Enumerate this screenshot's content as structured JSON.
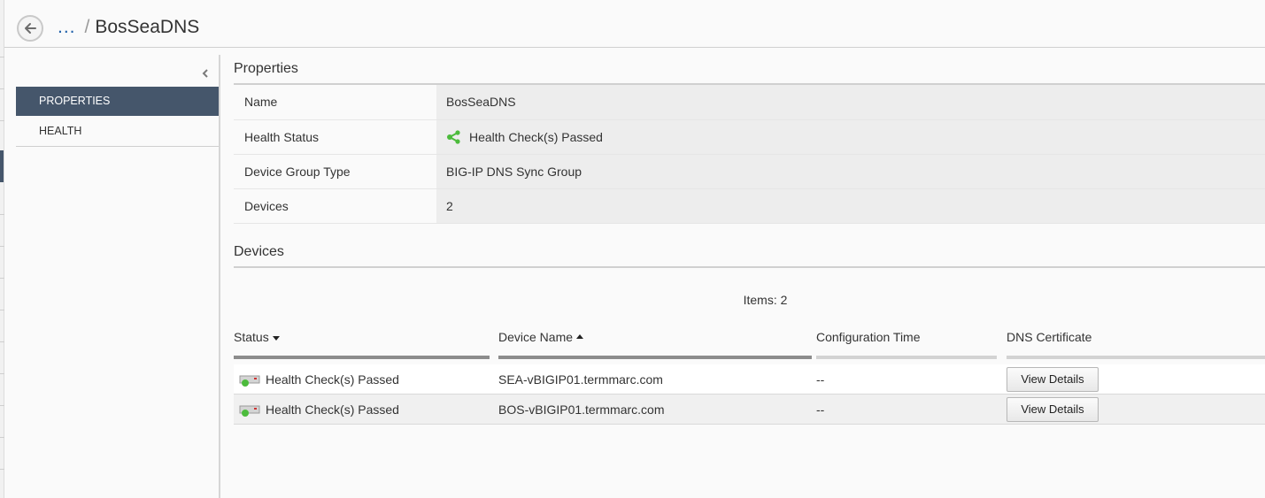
{
  "header": {
    "back_icon": "arrow-left-icon",
    "breadcrumb_more": "...",
    "breadcrumb_separator": "/",
    "breadcrumb_current": "BosSeaDNS"
  },
  "sidebar": {
    "collapse_icon": "chevron-left-icon",
    "items": [
      {
        "label": "PROPERTIES",
        "active": true
      },
      {
        "label": "HEALTH",
        "active": false
      }
    ]
  },
  "properties": {
    "title": "Properties",
    "rows": [
      {
        "label": "Name",
        "value": "BosSeaDNS"
      },
      {
        "label": "Health Status",
        "value": "Health Check(s) Passed",
        "icon": "health-network-icon"
      },
      {
        "label": "Device Group Type",
        "value": "BIG-IP DNS Sync Group"
      },
      {
        "label": "Devices",
        "value": "2"
      }
    ]
  },
  "devices": {
    "title": "Devices",
    "items_count": "Items: 2",
    "columns": [
      "Status",
      "Device Name",
      "Configuration Time",
      "DNS Certificate"
    ],
    "rows": [
      {
        "status": "Health Check(s) Passed",
        "device_name": "SEA-vBIGIP01.termmarc.com",
        "config_time": "--",
        "button": "View Details"
      },
      {
        "status": "Health Check(s) Passed",
        "device_name": "BOS-vBIGIP01.termmarc.com",
        "config_time": "--",
        "button": "View Details"
      }
    ]
  },
  "colors": {
    "nav_active": "#45566b",
    "link": "#1c5ea8",
    "status_green": "#4cbb3c"
  }
}
